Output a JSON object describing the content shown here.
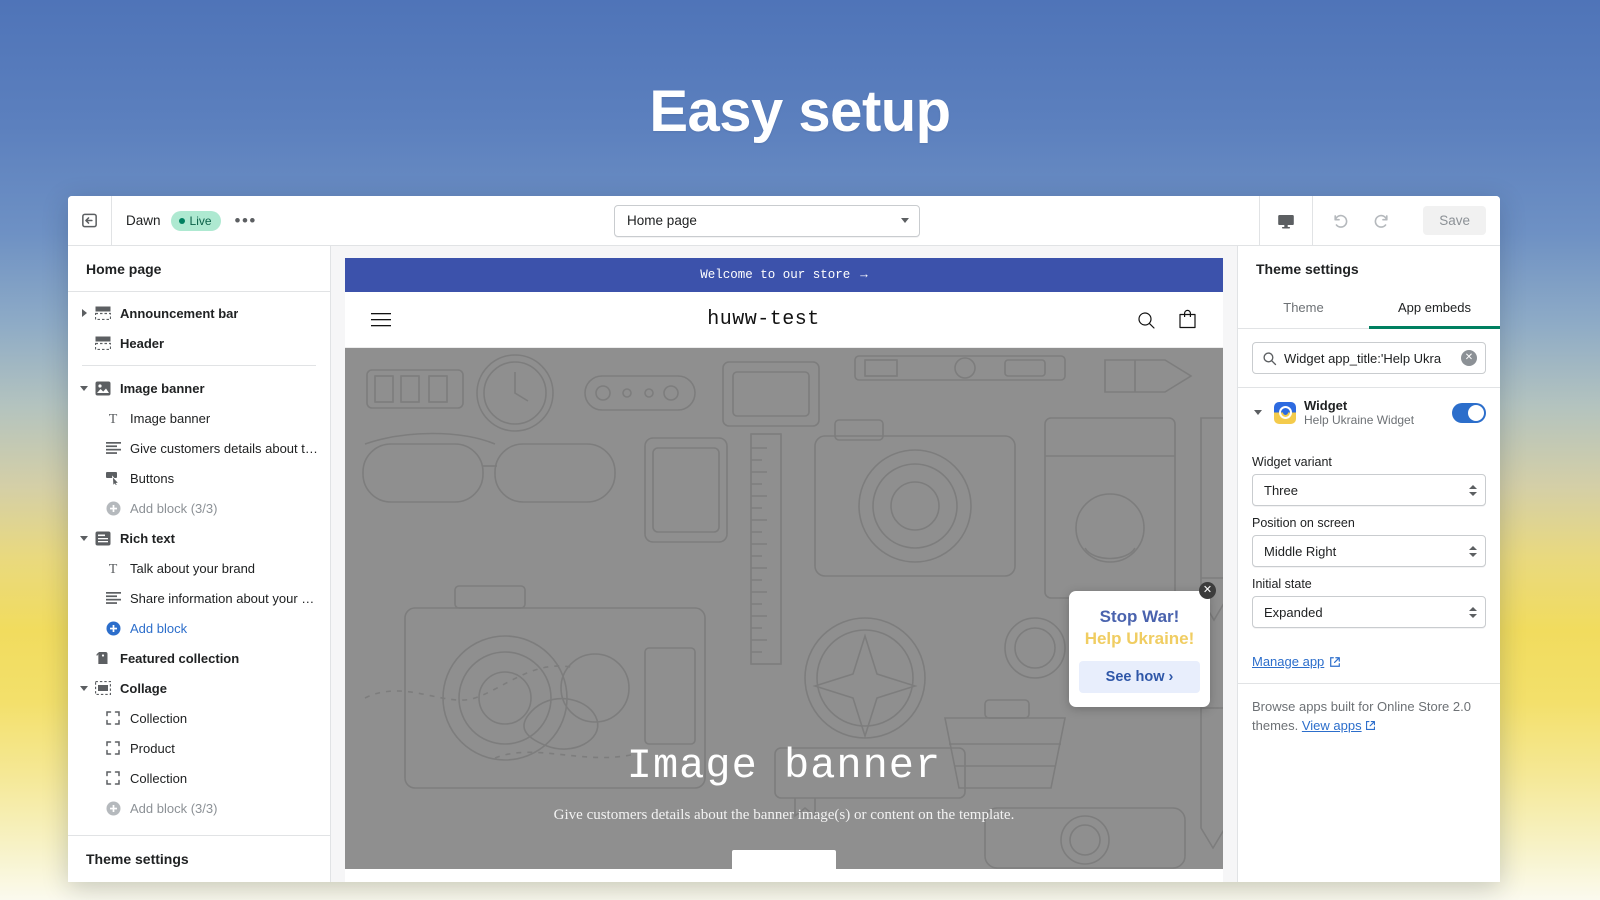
{
  "hero": {
    "title": "Easy setup"
  },
  "toolbar": {
    "exit_icon": "exit-icon",
    "theme_name": "Dawn",
    "live_badge": "Live",
    "more_label": "•••",
    "page_select_value": "Home page",
    "device_icon": "desktop-icon",
    "undo_icon": "undo-icon",
    "redo_icon": "redo-icon",
    "save_label": "Save"
  },
  "sidebar": {
    "title": "Home page",
    "footer": "Theme settings",
    "items": [
      {
        "label": "Announcement bar",
        "type": "section",
        "icon": "announcement-bar-icon",
        "toggle": "collapsed"
      },
      {
        "label": "Header",
        "type": "section",
        "icon": "header-icon",
        "toggle": "none"
      },
      {
        "label": "__separator__",
        "type": "separator"
      },
      {
        "label": "Image banner",
        "type": "section",
        "icon": "image-banner-icon",
        "toggle": "expanded"
      },
      {
        "label": "Image banner",
        "type": "block",
        "icon": "text-icon"
      },
      {
        "label": "Give customers details about t…",
        "type": "block",
        "icon": "paragraph-icon"
      },
      {
        "label": "Buttons",
        "type": "block",
        "icon": "button-icon"
      },
      {
        "label": "Add block (3/3)",
        "type": "addblock-disabled",
        "icon": "plus-circle-icon"
      },
      {
        "label": "Rich text",
        "type": "section",
        "icon": "rich-text-icon",
        "toggle": "expanded"
      },
      {
        "label": "Talk about your brand",
        "type": "block",
        "icon": "text-icon"
      },
      {
        "label": "Share information about your b…",
        "type": "block",
        "icon": "paragraph-icon"
      },
      {
        "label": "Add block",
        "type": "addblock",
        "icon": "plus-circle-icon"
      },
      {
        "label": "Featured collection",
        "type": "section",
        "icon": "collection-icon",
        "toggle": "none"
      },
      {
        "label": "Collage",
        "type": "section",
        "icon": "collage-icon",
        "toggle": "expanded"
      },
      {
        "label": "Collection",
        "type": "block",
        "icon": "frame-icon"
      },
      {
        "label": "Product",
        "type": "block",
        "icon": "frame-icon"
      },
      {
        "label": "Collection",
        "type": "block",
        "icon": "frame-icon"
      },
      {
        "label": "Add block (3/3)",
        "type": "addblock-disabled",
        "icon": "plus-circle-icon"
      }
    ]
  },
  "preview": {
    "announcement": "Welcome to our store",
    "announcement_arrow": "→",
    "menu_icon": "hamburger-icon",
    "store_name": "huww-test",
    "search_icon": "search-icon",
    "cart_icon": "cart-icon",
    "banner_heading": "Image banner",
    "banner_subtext": "Give customers details about the banner image(s) or content on the template.",
    "widget": {
      "close_icon": "close-icon",
      "line1": "Stop War!",
      "line2": "Help Ukraine!",
      "button": "See how ›",
      "line1_color": "#4a63ae",
      "line2_color": "#f0cd62"
    }
  },
  "right_panel": {
    "title": "Theme settings",
    "tabs": [
      {
        "label": "Theme",
        "active": false
      },
      {
        "label": "App embeds",
        "active": true
      }
    ],
    "accent_color": "#008060",
    "search": {
      "icon": "search-icon",
      "value": "Widget app_title:'Help Ukra",
      "clear_icon": "clear-icon"
    },
    "app": {
      "icon": "help-ukraine-widget-icon",
      "title": "Widget",
      "subtitle": "Help Ukraine Widget",
      "enabled": true
    },
    "fields": [
      {
        "label": "Widget variant",
        "value": "Three"
      },
      {
        "label": "Position on screen",
        "value": "Middle Right"
      },
      {
        "label": "Initial state",
        "value": "Expanded"
      }
    ],
    "manage_link": "Manage app",
    "footer_text_before": "Browse apps built for Online Store 2.0 themes. ",
    "footer_link": "View apps"
  }
}
